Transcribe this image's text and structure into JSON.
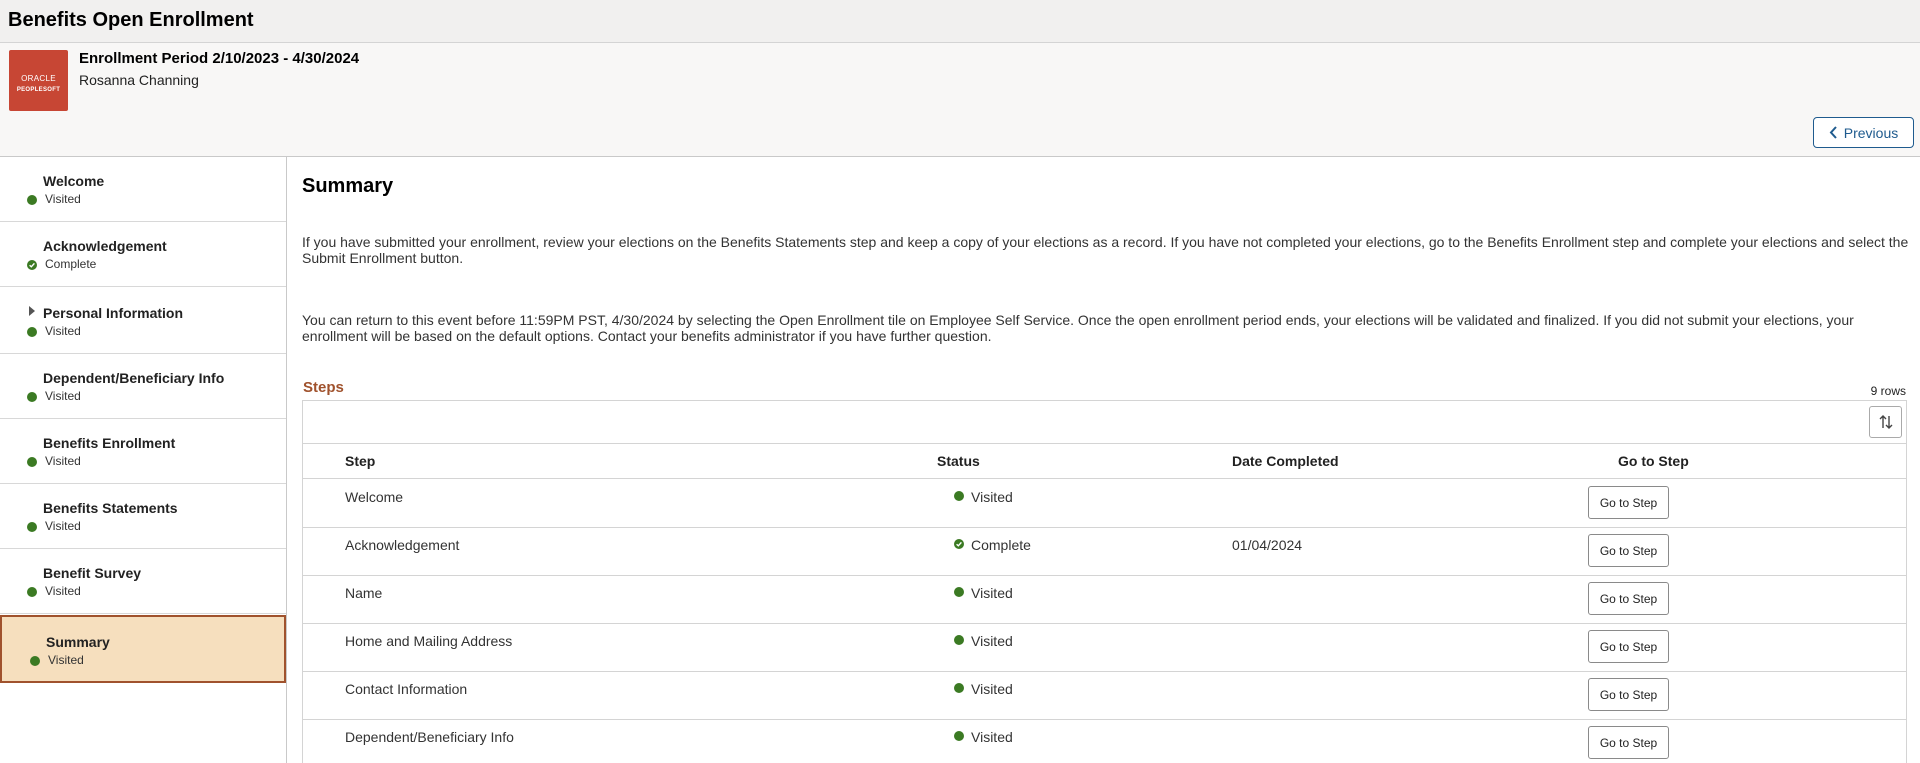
{
  "app": {
    "title": "Benefits Open Enrollment"
  },
  "header": {
    "logo_line1": "ORACLE",
    "logo_line2": "PEOPLESOFT",
    "period": "Enrollment Period 2/10/2023 - 4/30/2024",
    "person": "Rosanna Channing",
    "previous_label": "Previous"
  },
  "sidebar": {
    "items": [
      {
        "label": "Welcome",
        "status": "Visited"
      },
      {
        "label": "Acknowledgement",
        "status": "Complete"
      },
      {
        "label": "Personal Information",
        "status": "Visited"
      },
      {
        "label": "Dependent/Beneficiary Info",
        "status": "Visited"
      },
      {
        "label": "Benefits Enrollment",
        "status": "Visited"
      },
      {
        "label": "Benefits Statements",
        "status": "Visited"
      },
      {
        "label": "Benefit Survey",
        "status": "Visited"
      },
      {
        "label": "Summary",
        "status": "Visited"
      }
    ]
  },
  "main": {
    "title": "Summary",
    "para1": "If you have submitted your enrollment, review your elections on the Benefits Statements step and keep a copy of your elections as a record. If you have not completed your elections, go to the Benefits Enrollment step and complete your elections and select the Submit Enrollment button.",
    "para2": "You can return to this event before 11:59PM PST, 4/30/2024 by selecting the Open Enrollment tile on Employee Self Service. Once the open enrollment period ends, your elections will be validated and finalized. If you did not submit your elections, your enrollment will be based on the default options.  Contact your benefits administrator if you have further question.",
    "steps_title": "Steps",
    "rows_count": "9 rows",
    "columns": {
      "step": "Step",
      "status": "Status",
      "date": "Date Completed",
      "go": "Go to Step"
    },
    "go_label": "Go to Step",
    "rows": [
      {
        "step": "Welcome",
        "status": "Visited",
        "date": ""
      },
      {
        "step": "Acknowledgement",
        "status": "Complete",
        "date": "01/04/2024"
      },
      {
        "step": "Name",
        "status": "Visited",
        "date": ""
      },
      {
        "step": "Home and Mailing Address",
        "status": "Visited",
        "date": ""
      },
      {
        "step": "Contact Information",
        "status": "Visited",
        "date": ""
      },
      {
        "step": "Dependent/Beneficiary Info",
        "status": "Visited",
        "date": ""
      }
    ]
  },
  "colors": {
    "visited": "#3b7a23",
    "accent": "#a0522d",
    "active_bg": "#f6dfbe",
    "link": "#1f5b8e"
  }
}
